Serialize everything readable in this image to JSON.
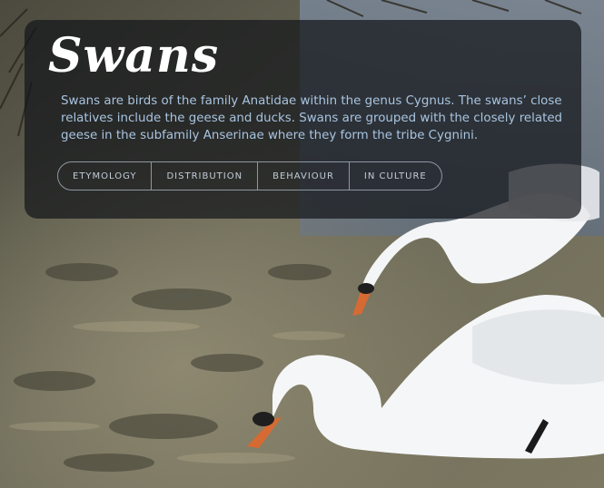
{
  "hero": {
    "title": "Swans",
    "description": "Swans are birds of the family Anatidae within the genus Cygnus. The swans’ close relatives include the geese and ducks. Swans are grouped with the closely related geese in the subfamily Anserinae where they form the tribe Cygnini."
  },
  "tabs": [
    {
      "label": "ETYMOLOGY"
    },
    {
      "label": "DISTRIBUTION"
    },
    {
      "label": "BEHAVIOUR"
    },
    {
      "label": "IN CULTURE"
    }
  ],
  "colors": {
    "card_background": "#14161a",
    "description_text": "#a9c4e0",
    "tab_text": "#c3ccd6",
    "tab_border": "#8e97a2"
  }
}
